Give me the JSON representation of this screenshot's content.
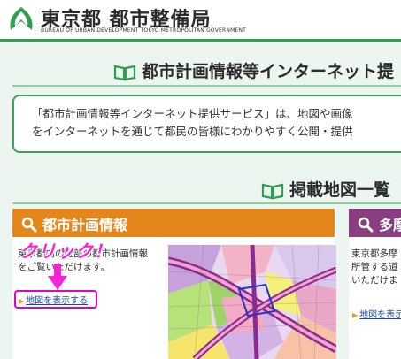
{
  "header": {
    "org_name": "東京都 都市整備局",
    "org_name_en": "BUREAU OF URBAN DEVELOPMENT TOKYO METROPOLITAN GOVERNMENT"
  },
  "section1": {
    "title": "都市計画情報等インターネット提",
    "intro_line1": "「都市計画情報等インターネット提供サービス」は、地図や画像",
    "intro_line2": "をインターネットを通じて都民の皆様にわかりやすく公開・提供"
  },
  "section2": {
    "title": "掲載地図一覧"
  },
  "card1": {
    "title": "都市計画情報",
    "desc_line1": "東京都内の区部の都市計画情報",
    "desc_line2": "をご覧いただけます。",
    "link": "地図を表示する"
  },
  "card2": {
    "title": "多摩",
    "desc_line1": "東京都多摩",
    "desc_line2": "所管する道",
    "desc_line3": "いただけま",
    "link": "地図を表示"
  },
  "annotation": {
    "text": "クリック！"
  },
  "colors": {
    "brand_green": "#2e9e4f",
    "card1_header": "#e3861c",
    "card2_header": "#8a3d80",
    "annotation": "#ff1fd8"
  }
}
